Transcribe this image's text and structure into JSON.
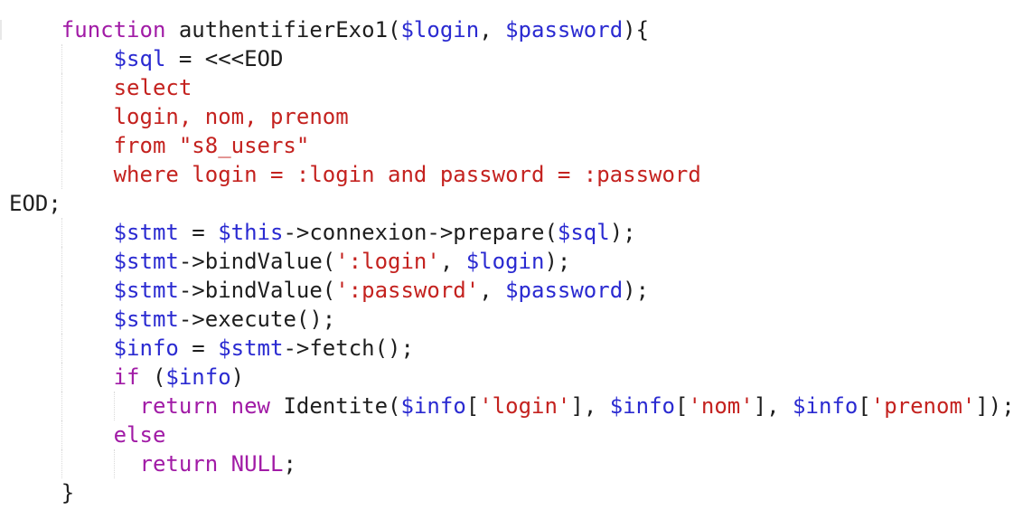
{
  "colors": {
    "keyword": "#a11ba6",
    "variable": "#2a2ad1",
    "string": "#c4221f",
    "plain": "#1e1e1e",
    "background": "#ffffff"
  },
  "code_lines": [
    {
      "indent": "    ",
      "tokens": [
        {
          "t": "kw",
          "v": "function"
        },
        {
          "t": "txt",
          "v": " authentifierExo1("
        },
        {
          "t": "var",
          "v": "$login"
        },
        {
          "t": "txt",
          "v": ", "
        },
        {
          "t": "var",
          "v": "$password"
        },
        {
          "t": "txt",
          "v": "){"
        }
      ]
    },
    {
      "indent": "        ",
      "tokens": [
        {
          "t": "var",
          "v": "$sql"
        },
        {
          "t": "txt",
          "v": " = <<<EOD"
        }
      ]
    },
    {
      "indent": "        ",
      "tokens": [
        {
          "t": "str",
          "v": "select"
        }
      ]
    },
    {
      "indent": "        ",
      "tokens": [
        {
          "t": "str",
          "v": "login, nom, prenom"
        }
      ]
    },
    {
      "indent": "        ",
      "tokens": [
        {
          "t": "str",
          "v": "from \"s8_users\""
        }
      ]
    },
    {
      "indent": "        ",
      "tokens": [
        {
          "t": "str",
          "v": "where login = :login and password = :password"
        }
      ]
    },
    {
      "indent": "",
      "tokens": [
        {
          "t": "txt",
          "v": "EOD;"
        }
      ]
    },
    {
      "indent": "        ",
      "tokens": [
        {
          "t": "var",
          "v": "$stmt"
        },
        {
          "t": "txt",
          "v": " = "
        },
        {
          "t": "var",
          "v": "$this"
        },
        {
          "t": "txt",
          "v": "->connexion->prepare("
        },
        {
          "t": "var",
          "v": "$sql"
        },
        {
          "t": "txt",
          "v": ");"
        }
      ]
    },
    {
      "indent": "        ",
      "tokens": [
        {
          "t": "var",
          "v": "$stmt"
        },
        {
          "t": "txt",
          "v": "->bindValue("
        },
        {
          "t": "str",
          "v": "':login'"
        },
        {
          "t": "txt",
          "v": ", "
        },
        {
          "t": "var",
          "v": "$login"
        },
        {
          "t": "txt",
          "v": ");"
        }
      ]
    },
    {
      "indent": "        ",
      "tokens": [
        {
          "t": "var",
          "v": "$stmt"
        },
        {
          "t": "txt",
          "v": "->bindValue("
        },
        {
          "t": "str",
          "v": "':password'"
        },
        {
          "t": "txt",
          "v": ", "
        },
        {
          "t": "var",
          "v": "$password"
        },
        {
          "t": "txt",
          "v": ");"
        }
      ]
    },
    {
      "indent": "        ",
      "tokens": [
        {
          "t": "var",
          "v": "$stmt"
        },
        {
          "t": "txt",
          "v": "->execute();"
        }
      ]
    },
    {
      "indent": "        ",
      "tokens": [
        {
          "t": "var",
          "v": "$info"
        },
        {
          "t": "txt",
          "v": " = "
        },
        {
          "t": "var",
          "v": "$stmt"
        },
        {
          "t": "txt",
          "v": "->fetch();"
        }
      ]
    },
    {
      "indent": "        ",
      "tokens": [
        {
          "t": "kw",
          "v": "if"
        },
        {
          "t": "txt",
          "v": " ("
        },
        {
          "t": "var",
          "v": "$info"
        },
        {
          "t": "txt",
          "v": ")"
        }
      ]
    },
    {
      "indent": "          ",
      "tokens": [
        {
          "t": "kw",
          "v": "return"
        },
        {
          "t": "txt",
          "v": " "
        },
        {
          "t": "kw",
          "v": "new"
        },
        {
          "t": "txt",
          "v": " Identite("
        },
        {
          "t": "var",
          "v": "$info"
        },
        {
          "t": "txt",
          "v": "["
        },
        {
          "t": "str",
          "v": "'login'"
        },
        {
          "t": "txt",
          "v": "], "
        },
        {
          "t": "var",
          "v": "$info"
        },
        {
          "t": "txt",
          "v": "["
        },
        {
          "t": "str",
          "v": "'nom'"
        },
        {
          "t": "txt",
          "v": "], "
        },
        {
          "t": "var",
          "v": "$info"
        },
        {
          "t": "txt",
          "v": "["
        },
        {
          "t": "str",
          "v": "'prenom'"
        },
        {
          "t": "txt",
          "v": "]);"
        }
      ]
    },
    {
      "indent": "        ",
      "tokens": [
        {
          "t": "kw",
          "v": "else"
        }
      ]
    },
    {
      "indent": "          ",
      "tokens": [
        {
          "t": "kw",
          "v": "return"
        },
        {
          "t": "txt",
          "v": " "
        },
        {
          "t": "kw",
          "v": "NULL"
        },
        {
          "t": "txt",
          "v": ";"
        }
      ]
    },
    {
      "indent": "    ",
      "tokens": [
        {
          "t": "txt",
          "v": "}"
        }
      ]
    }
  ]
}
